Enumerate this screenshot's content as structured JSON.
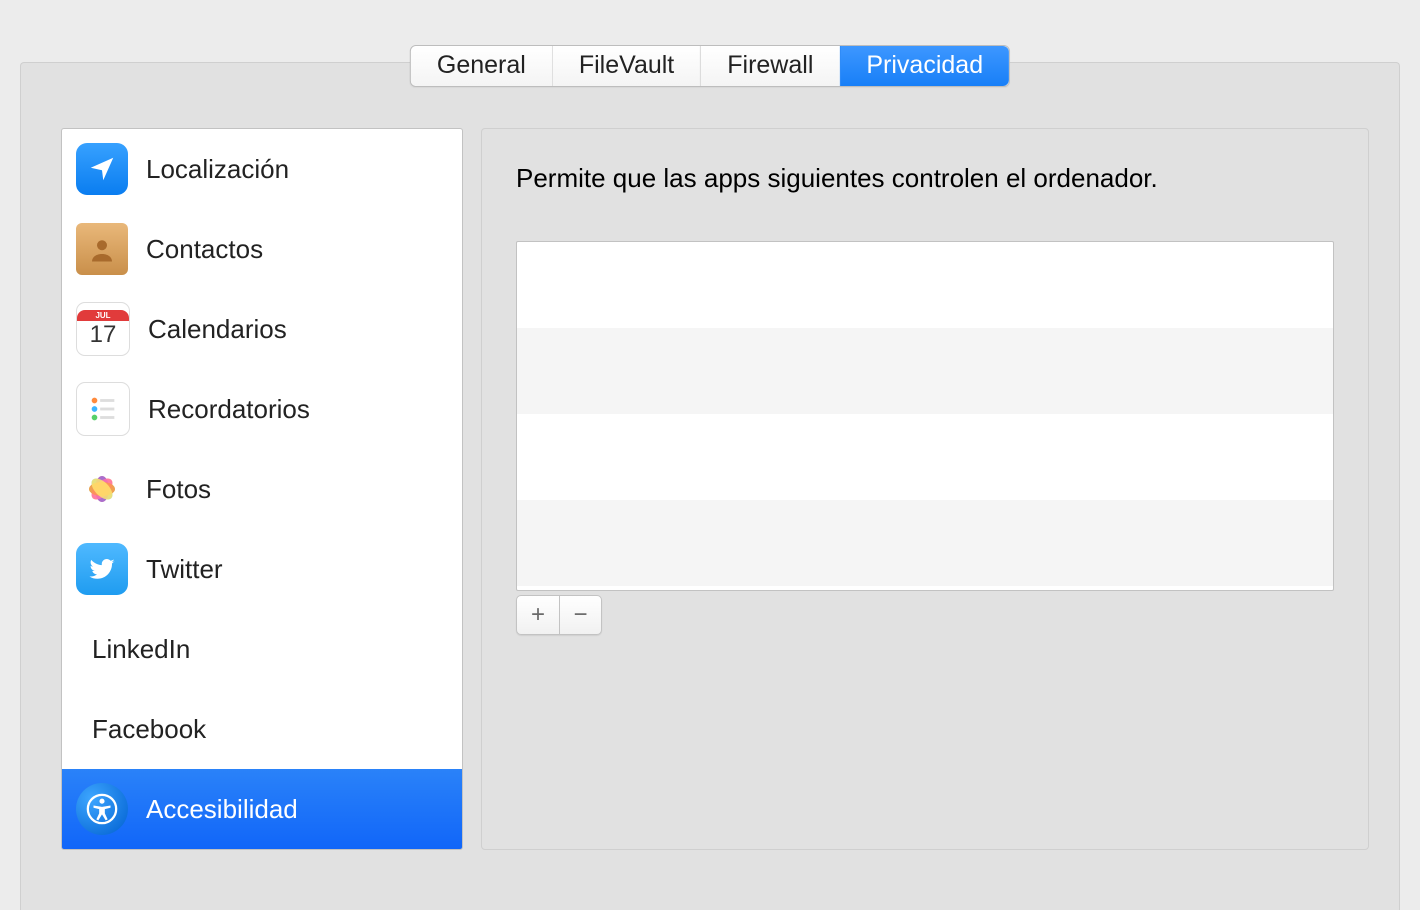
{
  "tabs": [
    {
      "label": "General",
      "active": false
    },
    {
      "label": "FileVault",
      "active": false
    },
    {
      "label": "Firewall",
      "active": false
    },
    {
      "label": "Privacidad",
      "active": true
    }
  ],
  "sidebar": {
    "items": [
      {
        "label": "Localización",
        "icon": "location-icon",
        "selected": false
      },
      {
        "label": "Contactos",
        "icon": "contacts-icon",
        "selected": false
      },
      {
        "label": "Calendarios",
        "icon": "calendar-icon",
        "selected": false
      },
      {
        "label": "Recordatorios",
        "icon": "reminders-icon",
        "selected": false
      },
      {
        "label": "Fotos",
        "icon": "photos-icon",
        "selected": false
      },
      {
        "label": "Twitter",
        "icon": "twitter-icon",
        "selected": false
      },
      {
        "label": "LinkedIn",
        "icon": null,
        "selected": false
      },
      {
        "label": "Facebook",
        "icon": null,
        "selected": false
      },
      {
        "label": "Accesibilidad",
        "icon": "accessibility-icon",
        "selected": true
      }
    ]
  },
  "calendar_badge": {
    "month": "JUL",
    "day": "17"
  },
  "detail": {
    "message": "Permite que las apps siguientes controlen el ordenador.",
    "app_rows": 4,
    "add_label": "+",
    "remove_label": "−"
  }
}
